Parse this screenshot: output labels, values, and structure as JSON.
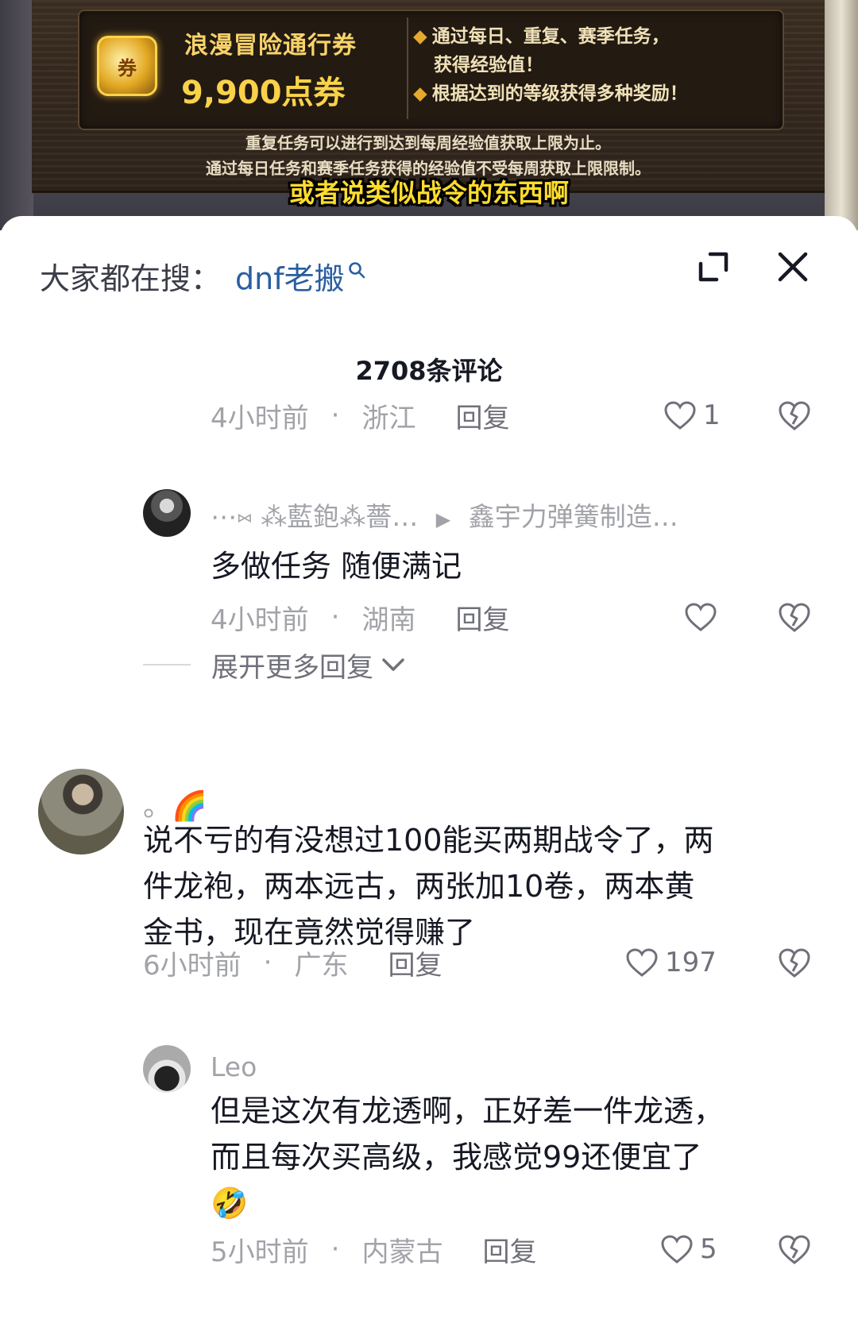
{
  "video": {
    "pass_title": "浪漫冒险通行券",
    "pass_price": "9,900点券",
    "ticket_icon_text": "券",
    "desc": [
      "通过每日、重复、赛季任务，",
      "获得经验值！",
      "根据达到的等级获得多种奖励！"
    ],
    "note1": "重复任务可以进行到达到每周经验值获取上限为止。",
    "note2": "通过每日任务和赛季任务获得的经验值不受每周获取上限限制。",
    "subtitle": "或者说类似战令的东西啊"
  },
  "header": {
    "search_label": "大家都在搜：",
    "search_term": "dnf老搬",
    "count_title": "2708条评论"
  },
  "comments": {
    "reply0": {
      "time": "4小时前",
      "location": "浙江",
      "reply_label": "回复",
      "likes": "1"
    },
    "reply1": {
      "user": "⋯⑅ ⁂藍鉋⁂薔…",
      "reply_to": "鑫宇力弹簧制造…",
      "text": "多做任务 随便满记",
      "time": "4小时前",
      "location": "湖南",
      "reply_label": "回复",
      "likes": ""
    },
    "expand_more": "展开更多回复",
    "main": {
      "user": "。🌈",
      "text_lines": [
        "说不亏的有没想过100能买两期战令了，两",
        "件龙袍，两本远古，两张加10卷，两本黄",
        "金书，现在竟然觉得赚了"
      ],
      "time": "6小时前",
      "location": "广东",
      "reply_label": "回复",
      "likes": "197"
    },
    "reply2": {
      "user": "Leo",
      "text_lines": [
        "但是这次有龙透啊，正好差一件龙透，",
        "而且每次买高级，我感觉99还便宜了",
        "🤣"
      ],
      "time": "5小时前",
      "location": "内蒙古",
      "reply_label": "回复",
      "likes": "5"
    }
  },
  "icons": {
    "expand": "expand-icon",
    "close": "close-icon",
    "heart": "heart-icon",
    "dislike": "broken-heart-icon",
    "chevron": "chevron-down-icon",
    "search": "search-icon"
  },
  "colors": {
    "search_link": "#2a5ea0",
    "meta_text": "#a2a3a8",
    "subtitle_yellow": "#ffdc2e"
  }
}
